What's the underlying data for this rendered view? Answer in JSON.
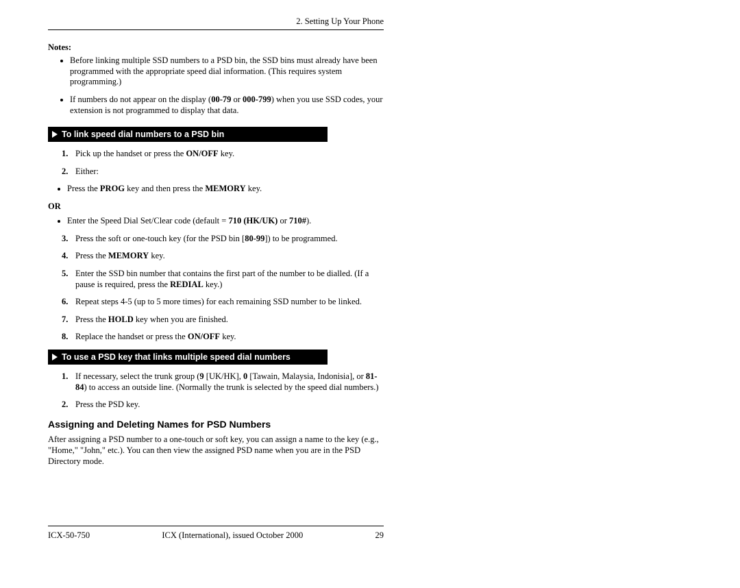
{
  "header": {
    "chapter": "2. Setting Up Your Phone"
  },
  "notes": {
    "label": "Notes:",
    "items": [
      "Before linking multiple SSD numbers to a PSD bin, the SSD bins must already have been programmed with the appropriate speed dial information. (This requires system programming.)",
      "If numbers do not appear on the display (00-79 or 000-799) when you use SSD codes, your extension is not programmed to display that data."
    ],
    "bold_ranges": {
      "1": [
        "00-79",
        "000-799"
      ]
    }
  },
  "bar1": "To link speed dial numbers to a PSD bin",
  "steps1": {
    "s1": {
      "num": "1.",
      "text": "Pick up the handset or press the ",
      "bold": "ON/OFF",
      "after": " key."
    },
    "s2": {
      "num": "2.",
      "text": "Either:"
    },
    "s2a": {
      "pre": "Press the ",
      "b1": "PROG",
      "mid": " key and then press the ",
      "b2": "MEMORY",
      "post": " key."
    },
    "or": "OR",
    "s2b": {
      "pre": "Enter the Speed Dial Set/Clear code (default = ",
      "b1": "710 (HK/UK)",
      "mid": " or ",
      "b2": "710#",
      "post": ")."
    },
    "s3": {
      "num": "3.",
      "pre": "Press the soft or one-touch key (for the PSD bin [",
      "b1": "80-99",
      "post": "]) to be programmed."
    },
    "s4": {
      "num": "4.",
      "pre": "Press the ",
      "b1": "MEMORY",
      "post": " key."
    },
    "s5": {
      "num": "5.",
      "pre": "Enter the SSD bin number that contains the first part of the number to be dialled. (If a pause is required, press the ",
      "b1": "REDIAL",
      "post": " key.)"
    },
    "s6": {
      "num": "6.",
      "text": "Repeat steps 4-5 (up to 5 more times) for each remaining SSD number to be linked."
    },
    "s7": {
      "num": "7.",
      "pre": "Press the ",
      "b1": "HOLD",
      "post": " key when you are finished."
    },
    "s8": {
      "num": "8.",
      "pre": "Replace the handset or press the ",
      "b1": "ON/OFF",
      "post": " key."
    }
  },
  "bar2": "To use a PSD key that links multiple speed dial numbers",
  "steps2": {
    "s1": {
      "num": "1.",
      "pre": "If necessary, select the trunk group (",
      "b1": "9",
      "mid1": " [UK/HK], ",
      "b2": "0",
      "mid2": " [Tawain, Malaysia, Indonisia], or ",
      "b3": "81-84",
      "post": ") to access an outside line. (Normally the trunk is selected by the speed dial numbers.)"
    },
    "s2": {
      "num": "2.",
      "text": "Press the PSD key."
    }
  },
  "heading": "Assigning and Deleting Names for PSD Numbers",
  "para": "After assigning a PSD number to a one-touch or soft key, you can assign a name to the key (e.g., \"Home,\" \"John,\" etc.). You can then view the assigned PSD name when you are in the PSD Directory mode.",
  "footer": {
    "left": "ICX-50-750",
    "center": "ICX (International), issued October 2000",
    "right": "29"
  }
}
